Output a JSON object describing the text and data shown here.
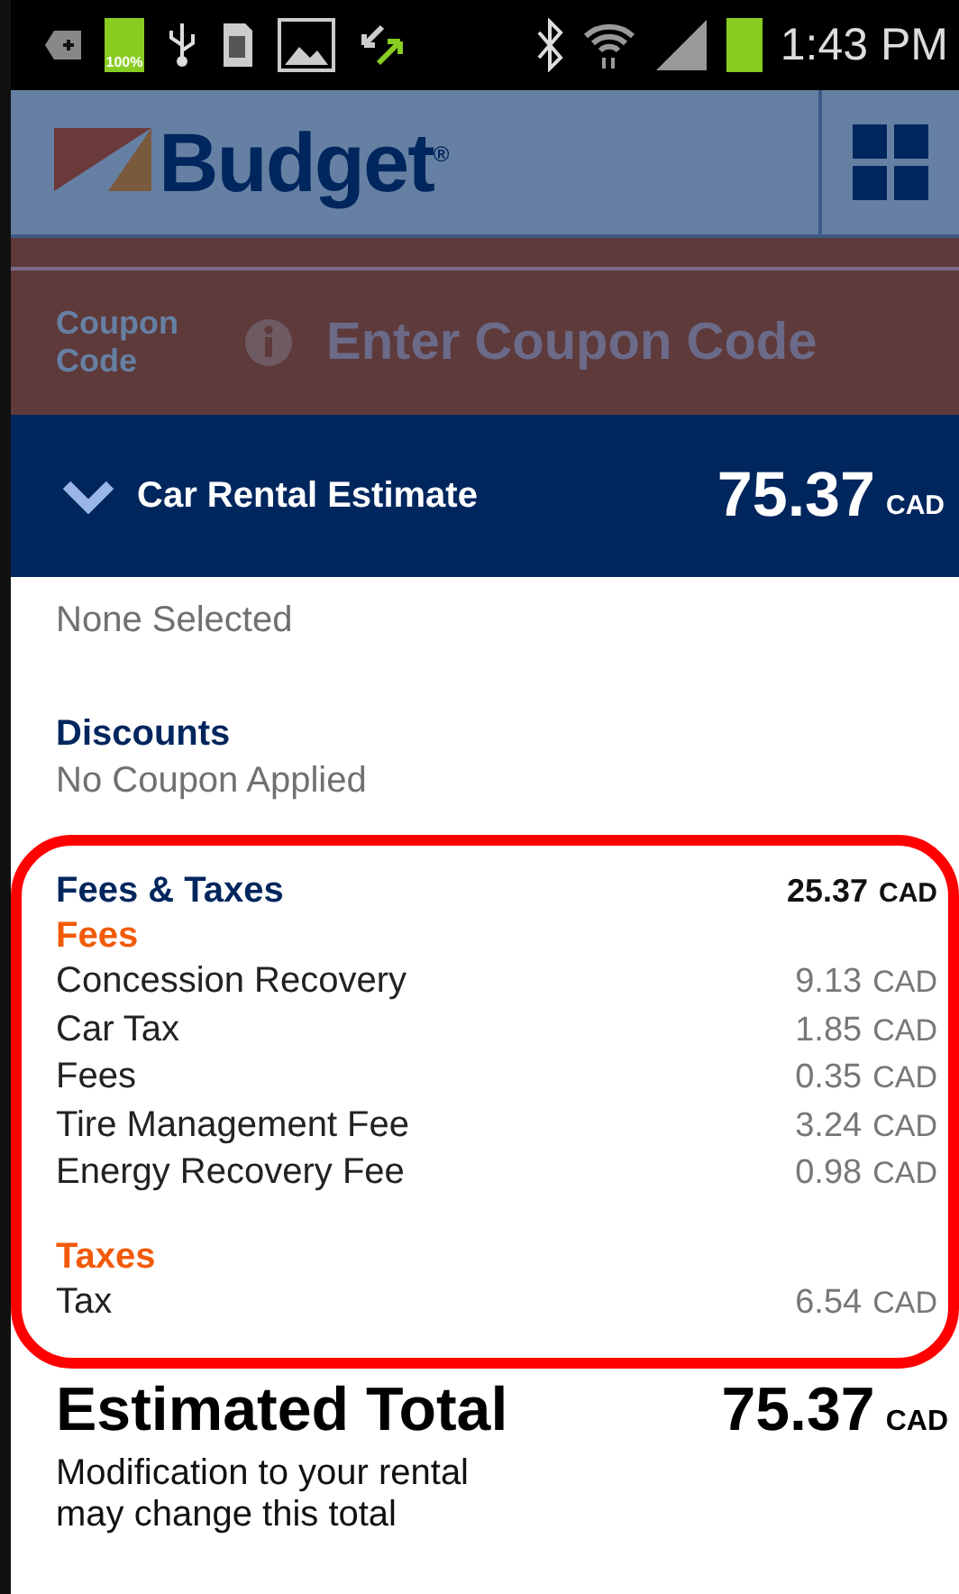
{
  "status_bar": {
    "battery_small": "100%",
    "time": "1:43 PM"
  },
  "header": {
    "logo": "Budget",
    "logo_mark": "®"
  },
  "coupon": {
    "label": "Coupon Code",
    "placeholder": "Enter Coupon Code"
  },
  "estimate_bar": {
    "title": "Car Rental Estimate",
    "amount": "75.37",
    "currency": "CAD",
    "expanded": true
  },
  "sections": [
    {
      "value": "None Selected"
    },
    {
      "title": "Discounts",
      "value": "No Coupon Applied"
    }
  ],
  "fees_taxes": {
    "title": "Fees & Taxes",
    "amount": "25.37",
    "currency": "CAD",
    "groups": [
      {
        "title": "Fees",
        "items": [
          {
            "label": "Concession Recovery",
            "amount": "9.13",
            "currency": "CAD"
          },
          {
            "label": "Car Tax",
            "amount": "1.85",
            "currency": "CAD"
          },
          {
            "label": "Fees",
            "amount": "0.35",
            "currency": "CAD"
          },
          {
            "label": "Tire Management Fee",
            "amount": "3.24",
            "currency": "CAD"
          },
          {
            "label": "Energy Recovery Fee",
            "amount": "0.98",
            "currency": "CAD"
          }
        ]
      },
      {
        "title": "Taxes",
        "items": [
          {
            "label": "Tax",
            "amount": "6.54",
            "currency": "CAD"
          }
        ]
      }
    ]
  },
  "total": {
    "title": "Estimated Total",
    "amount": "75.37",
    "currency": "CAD",
    "note": "Modification to your rental may change this total"
  }
}
